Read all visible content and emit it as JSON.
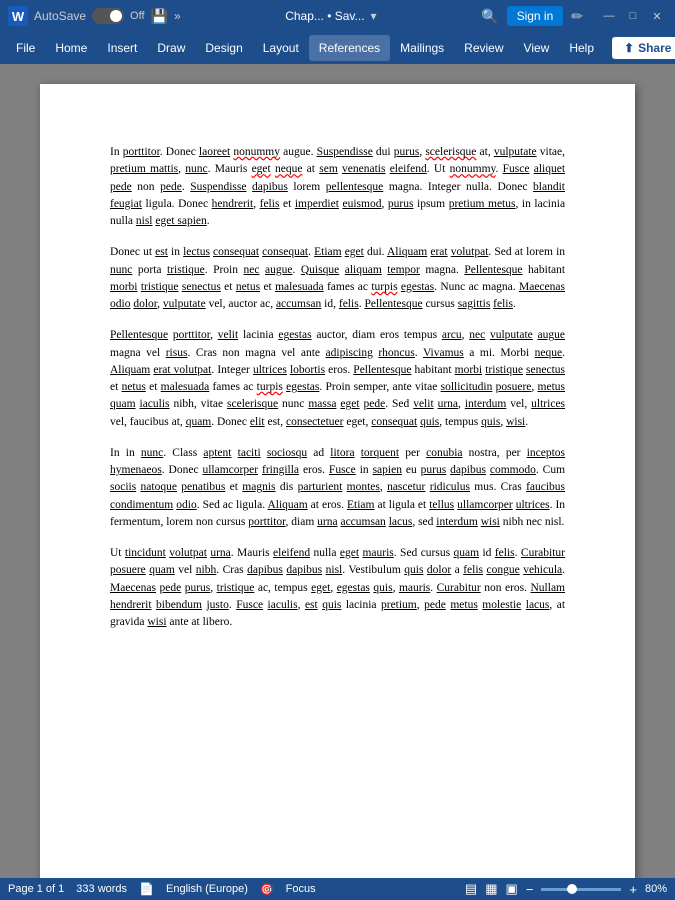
{
  "titlebar": {
    "word_label": "W",
    "autosave_label": "AutoSave",
    "toggle_state": "Off",
    "save_icon": "💾",
    "more_icon": "»",
    "doc_title": "Chap... • Sav...",
    "dropdown_arrow": "▾",
    "search_icon": "🔍",
    "signin_label": "Sign in",
    "pen_icon": "✏",
    "minimize_icon": "—",
    "maximize_icon": "□",
    "close_icon": "✕"
  },
  "ribbon": {
    "items": [
      "File",
      "Home",
      "Insert",
      "Draw",
      "Design",
      "Layout",
      "References",
      "Mailings",
      "Review",
      "View",
      "Help"
    ],
    "active_item": "References",
    "share_label": "Share",
    "share_arrow": "▾"
  },
  "document": {
    "paragraphs": [
      "In porttitor. Donec laoreet nonummy augue. Suspendisse dui purus, scelerisque at, vulputate vitae, pretium mattis, nunc. Mauris eget neque at sem venenatis eleifend. Ut nonummy. Fusce aliquet pede non pede. Suspendisse dapibus lorem pellentesque magna. Integer nulla. Donec blandit feugiat ligula. Donec hendrerit, felis et imperdiet euismod, purus ipsum pretium metus, in lacinia nulla nisl eget sapien.",
      "Donec ut est in lectus consequat consequat. Etiam eget dui. Aliquam erat volutpat. Sed at lorem in nunc porta tristique. Proin nec augue. Quisque aliquam tempor magna. Pellentesque habitant morbi tristique senectus et netus et malesuada fames ac turpis egestas. Nunc ac magna. Maecenas odio dolor, vulputate vel, auctor ac, accumsan id, felis. Pellentesque cursus sagittis felis.",
      "Pellentesque porttitor, velit lacinia egestas auctor, diam eros tempus arcu, nec vulputate augue magna vel risus. Cras non magna vel ante adipiscing rhoncus. Vivamus a mi. Morbi neque. Aliquam erat volutpat. Integer ultrices lobortis eros. Pellentesque habitant morbi tristique senectus et netus et malesuada fames ac turpis egestas. Proin semper, ante vitae sollicitudin posuere, metus quam iaculis nibh, vitae scelerisque nunc massa eget pede. Sed velit urna, interdum vel, ultrices vel, faucibus at, quam. Donec elit est, consectetuer eget, consequat quis, tempus quis, wisi.",
      "In in nunc. Class aptent taciti sociosqu ad litora torquent per conubia nostra, per inceptos hymenaeos. Donec ullamcorper fringilla eros. Fusce in sapien eu purus dapibus commodo. Cum sociis natoque penatibus et magnis dis parturient montes, nascetur ridiculus mus. Cras faucibus condimentum odio. Sed ac ligula. Aliquam at eros. Etiam at ligula et tellus ullamcorper ultrices. In fermentum, lorem non cursus porttitor, diam urna accumsan lacus, sed interdum wisi nibh nec nisl.",
      "Ut tincidunt volutpat urna. Mauris eleifend nulla eget mauris. Sed cursus quam id felis. Curabitur posuere quam vel nibh. Cras dapibus dapibus nisl. Vestibulum quis dolor a felis congue vehicula. Maecenas pede purus, tristique ac, tempus eget, egestas quis, mauris. Curabitur non eros. Nullam hendrerit bibendum justo. Fusce iaculis, est quis lacinia pretium, pede metus molestie lacus, at gravida wisi ante at libero."
    ]
  },
  "statusbar": {
    "page_info": "Page 1 of 1",
    "word_count": "333 words",
    "language": "English (Europe)",
    "focus_label": "Focus",
    "zoom_level": "80%",
    "zoom_value": 80
  }
}
